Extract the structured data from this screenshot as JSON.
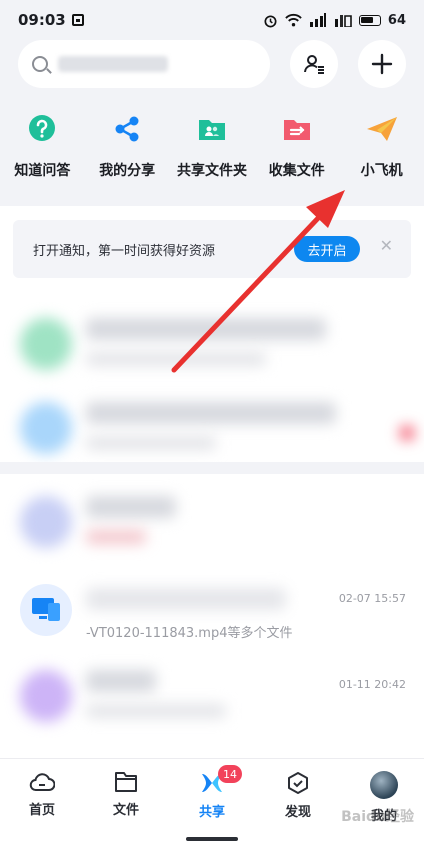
{
  "status": {
    "time": "09:03",
    "battery": "64"
  },
  "search": {
    "placeholder": ""
  },
  "quick_actions": [
    {
      "label": "知道问答",
      "icon": "question-icon",
      "color": "#1fbf9a"
    },
    {
      "label": "我的分享",
      "icon": "share-icon",
      "color": "#1684f5"
    },
    {
      "label": "共享文件夹",
      "icon": "shared-folder-icon",
      "color": "#1fbf9a"
    },
    {
      "label": "收集文件",
      "icon": "collect-folder-icon",
      "color": "#f25a6e"
    },
    {
      "label": "小飞机",
      "icon": "paper-plane-icon",
      "color": "#f7a23a"
    }
  ],
  "notice": {
    "text": "打开通知，第一时间获得好资源",
    "button": "去开启"
  },
  "rows": [
    {
      "title": "",
      "desc": "",
      "time": ""
    },
    {
      "title": "",
      "desc": "",
      "time": ""
    },
    {
      "title": "",
      "desc": "",
      "time": ""
    },
    {
      "title": "",
      "desc": "-VT0120-111843.mp4等多个文件",
      "time": "02-07 15:57"
    },
    {
      "title": "",
      "desc": "",
      "time": "01-11 20:42"
    }
  ],
  "tabs": [
    {
      "label": "首页",
      "icon": "cloud-icon"
    },
    {
      "label": "文件",
      "icon": "folder-icon"
    },
    {
      "label": "共享",
      "icon": "share-tab-icon",
      "badge": "14"
    },
    {
      "label": "发现",
      "icon": "discover-icon"
    },
    {
      "label": "我的",
      "icon": "avatar"
    }
  ],
  "watermark": "Baidu经验",
  "colors": {
    "accent": "#1684f5",
    "badge": "#f2425a",
    "arrow": "#e8312f"
  }
}
